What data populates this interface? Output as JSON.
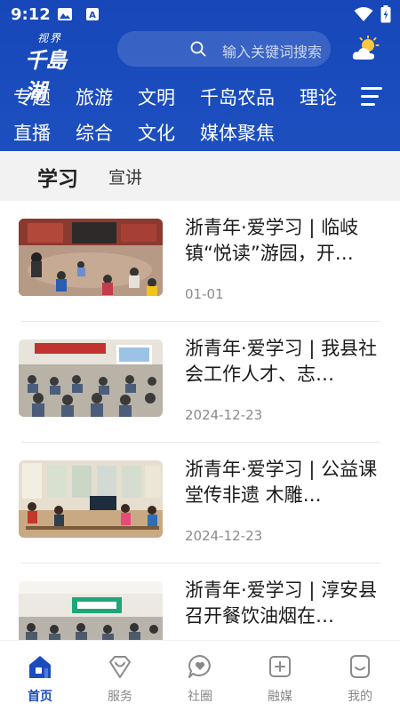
{
  "status_bar": {
    "time": "9:12"
  },
  "logo": {
    "line1": "视界",
    "line2": "千島湖"
  },
  "search": {
    "placeholder": "输入关键词搜索"
  },
  "nav": {
    "row1": [
      "专题",
      "旅游",
      "文明",
      "千岛农品",
      "理论"
    ],
    "row2": [
      "直播",
      "综合",
      "文化",
      "媒体聚焦"
    ]
  },
  "subtabs": {
    "active": "学习",
    "other": "宣讲"
  },
  "articles": [
    {
      "title": "浙青年·爱学习 | 临岐镇“悦读”游园，开…",
      "date": "01-01"
    },
    {
      "title": "浙青年·爱学习 | 我县社会工作人才、志…",
      "date": "2024-12-23"
    },
    {
      "title": "浙青年·爱学习 | 公益课堂传非遗 木雕…",
      "date": "2024-12-23"
    },
    {
      "title": "浙青年·爱学习 | 淳安县召开餐饮油烟在…",
      "date": ""
    }
  ],
  "bottom_nav": {
    "home": "首页",
    "service": "服务",
    "community": "社圈",
    "media": "融媒",
    "mine": "我的"
  },
  "colors": {
    "brand_blue": "#1a4cbd",
    "text_gray": "#8a8a8a"
  }
}
